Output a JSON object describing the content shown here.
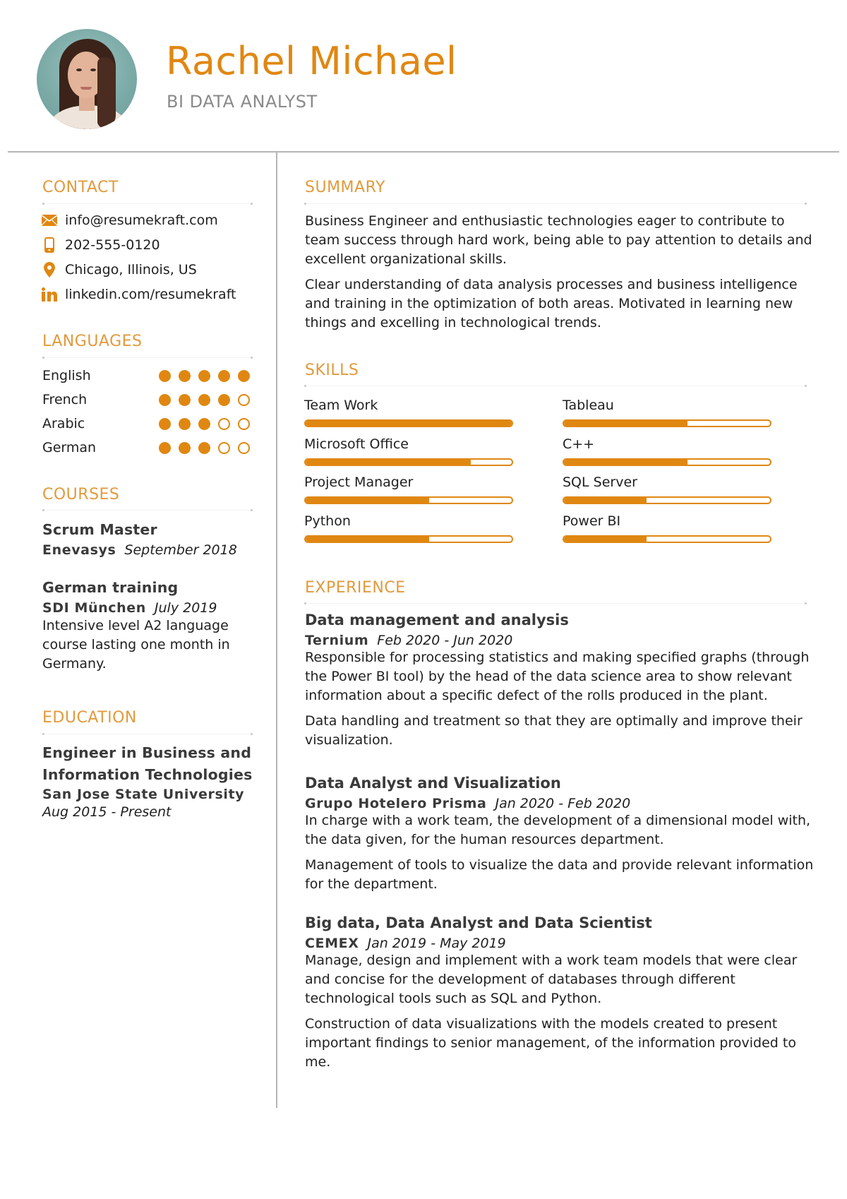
{
  "header": {
    "name": "Rachel Michael",
    "title": "BI DATA ANALYST",
    "photo_alt": "profile-photo"
  },
  "colors": {
    "accent": "#e08712",
    "heading": "#e29a3c",
    "subtitle": "#8a8a8a",
    "divider": "#b5b5b5"
  },
  "contact": {
    "heading": "CONTACT",
    "items": [
      {
        "icon": "envelope-icon",
        "text": "info@resumekraft.com"
      },
      {
        "icon": "phone-icon",
        "text": "202-555-0120"
      },
      {
        "icon": "location-pin-icon",
        "text": "Chicago, Illinois, US"
      },
      {
        "icon": "linkedin-icon",
        "text": "linkedin.com/resumekraft"
      }
    ]
  },
  "languages": {
    "heading": "LANGUAGES",
    "max_level": 5,
    "items": [
      {
        "name": "English",
        "level": 5
      },
      {
        "name": "French",
        "level": 4
      },
      {
        "name": "Arabic",
        "level": 3
      },
      {
        "name": "German",
        "level": 3
      }
    ]
  },
  "courses": {
    "heading": "COURSES",
    "items": [
      {
        "title": "Scrum Master",
        "org": "Enevasys",
        "date": "September 2018",
        "description": ""
      },
      {
        "title": "German training",
        "org": "SDI München",
        "date": "July 2019",
        "description": "Intensive level A2 language course lasting one month in Germany."
      }
    ]
  },
  "education": {
    "heading": "EDUCATION",
    "items": [
      {
        "degree_line1": "Engineer in Business and",
        "degree_line2": "Information Technologies",
        "school": "San Jose State University",
        "date": "Aug 2015 - Present"
      }
    ]
  },
  "summary": {
    "heading": "SUMMARY",
    "paragraphs": [
      "Business Engineer and enthusiastic technologies eager to contribute to team success through hard work, being able to pay attention to details and excellent organizational skills.",
      "Clear understanding of data analysis processes and business intelligence and training in the optimization of both areas. Motivated in learning new things and excelling in technological trends."
    ]
  },
  "skills": {
    "heading": "SKILLS",
    "items": [
      {
        "name": "Team Work",
        "level_pct": 100
      },
      {
        "name": "Tableau",
        "level_pct": 60
      },
      {
        "name": "Microsoft Office",
        "level_pct": 80
      },
      {
        "name": "C++",
        "level_pct": 60
      },
      {
        "name": "Project Manager",
        "level_pct": 60
      },
      {
        "name": "SQL Server",
        "level_pct": 40
      },
      {
        "name": "Python",
        "level_pct": 60
      },
      {
        "name": "Power BI",
        "level_pct": 40
      }
    ]
  },
  "experience": {
    "heading": "EXPERIENCE",
    "items": [
      {
        "title": "Data management and analysis",
        "company": "Ternium",
        "date": "Feb 2020 - Jun 2020",
        "paragraphs": [
          "Responsible for processing statistics and making specified graphs (through the Power BI tool) by the head of the data science area to show relevant information about a specific defect of the rolls produced in the plant.",
          "Data handling and treatment so that they are optimally and improve their visualization."
        ]
      },
      {
        "title": "Data Analyst and Visualization",
        "company": "Grupo Hotelero Prisma",
        "date": "Jan 2020 - Feb 2020",
        "paragraphs": [
          "In charge with a work team, the development of a dimensional model with, the data given, for the human resources department.",
          "Management of tools to visualize the data and provide relevant information for the department."
        ]
      },
      {
        "title": "Big data, Data Analyst and Data Scientist",
        "company": "CEMEX",
        "date": "Jan 2019 - May 2019",
        "paragraphs": [
          "Manage, design and implement with a work team models that were clear and concise for the development of databases through different technological tools such as SQL and Python.",
          "Construction of data visualizations with the models created to present important findings to senior management, of the information provided to me."
        ]
      }
    ]
  }
}
